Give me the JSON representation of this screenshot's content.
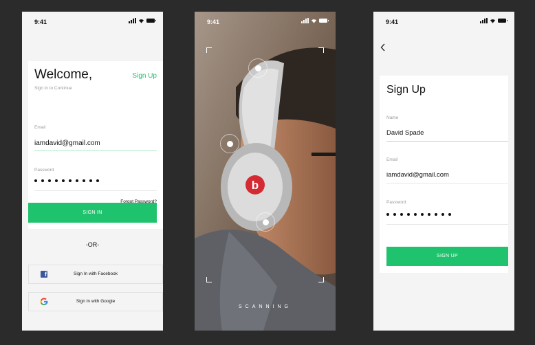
{
  "status": {
    "time": "9:41"
  },
  "signin": {
    "title": "Welcome,",
    "subtitle": "Sign in to Continue",
    "signup_link": "Sign Up",
    "email_label": "Email",
    "email_value": "iamdavid@gmail.com",
    "password_label": "Password",
    "password_mask_length": 10,
    "forgot_label": "Forgot Password?",
    "signin_button": "SIGN IN",
    "or_label": "-OR-",
    "facebook_label": "Sign In with Facebook",
    "google_label": "Sign In with Google"
  },
  "scan": {
    "status_label": "SCANNING"
  },
  "signup": {
    "back_icon": "chevron-left-icon",
    "title": "Sign Up",
    "name_label": "Name",
    "name_value": "David Spade",
    "email_label": "Email",
    "email_value": "iamdavid@gmail.com",
    "password_label": "Password",
    "password_mask_length": 10,
    "signup_button": "SIGN UP"
  },
  "colors": {
    "accent": "#1fc36d",
    "background": "#2b2b2b",
    "screen": "#f4f4f4",
    "facebook": "#3b5998"
  },
  "icons": [
    "signal-icon",
    "wifi-icon",
    "battery-icon",
    "facebook-icon",
    "google-icon",
    "chevron-left-icon"
  ]
}
